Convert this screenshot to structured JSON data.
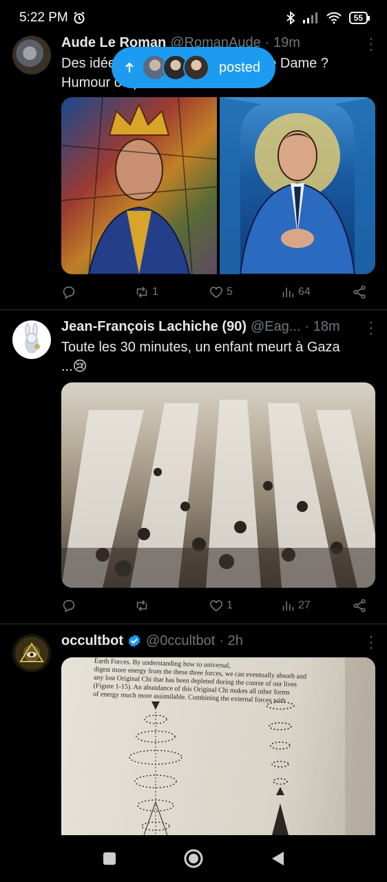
{
  "status_bar": {
    "time": "5:22 PM",
    "battery": "55"
  },
  "new_posts_pill": {
    "label": "posted"
  },
  "tweets": [
    {
      "name": "Aude Le Roman",
      "handle": "@RomanAude",
      "time": "· 19m",
      "text_line1": "Des idées pour les vitraux de Notre Dame ?",
      "text_line2": "Humour ou pas ? 😂",
      "replies": "",
      "retweets": "1",
      "likes": "5",
      "views": "64"
    },
    {
      "name": "Jean-François Lachiche (90)",
      "handle": "@Eag...",
      "time": "· 18m",
      "text_line1": "Toute les 30 minutes, un enfant meurt à Gaza",
      "text_line2": "...😢",
      "replies": "",
      "retweets": "",
      "likes": "1",
      "views": "27"
    },
    {
      "name": "occultbot",
      "handle": "@0ccultbot",
      "time": "· 2h",
      "page_lines": [
        "Earth Forces. By understanding how to universal,",
        "digest more energy from the these three forces, we can eventually absorb and",
        "any lost Original Chi that has been depleted during the course of our lives",
        "(Figure 1-15). An abundance of this Original Chi makes all other forms",
        "of energy much more assimilable. Combining the external forces with"
      ]
    }
  ],
  "colors": {
    "accent": "#1d9bf0",
    "muted": "#71767b",
    "text": "#e7e9ea",
    "divider": "#2f3336"
  },
  "icons": [
    "reply-icon",
    "retweet-icon",
    "like-icon",
    "views-icon",
    "share-icon",
    "verified-icon",
    "more-icon",
    "arrow-up-icon"
  ]
}
